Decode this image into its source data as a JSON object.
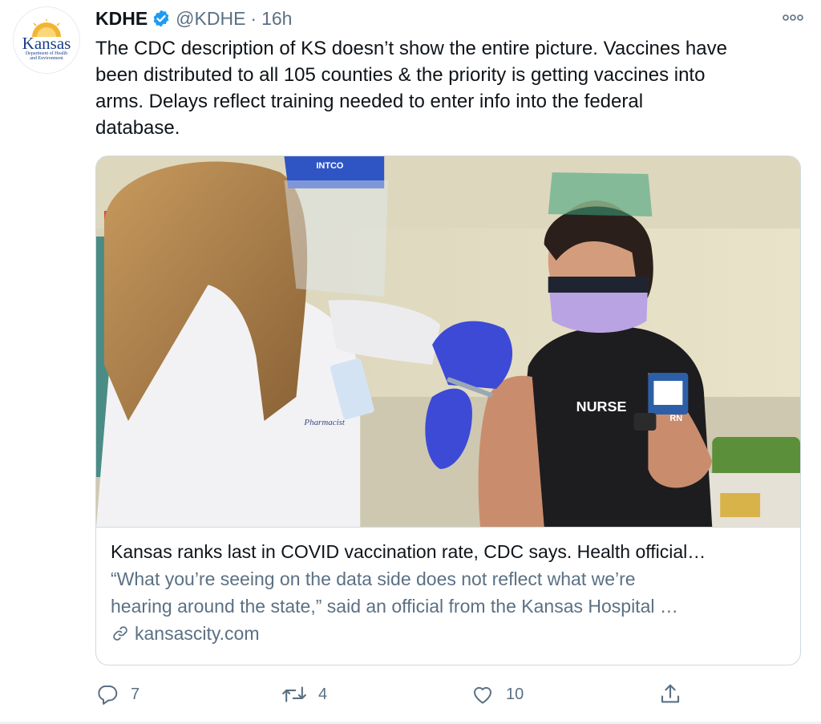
{
  "tweet": {
    "author_name": "KDHE",
    "handle": "@KDHE",
    "separator": "·",
    "time": "16h",
    "text": "The CDC description of KS doesn’t show the entire picture. Vaccines have\nbeen distributed to all 105 counties & the priority is getting vaccines into\narms. Delays reflect training needed to enter info into the federal\ndatabase."
  },
  "avatar": {
    "logo_word": "Kansas",
    "logo_sub": "Department of Health and Environment"
  },
  "card": {
    "image_overlay": {
      "cap_text": "INTCO",
      "shirt_text": "NURSE",
      "badge_text": "RN",
      "coat_name": "Pharmacist"
    },
    "title": "Kansas ranks last in COVID vaccination rate, CDC says. Health official…",
    "description": "“What you’re seeing on the data side does not reflect what we’re\nhearing around the state,” said an official from the Kansas Hospital …",
    "domain": "kansascity.com"
  },
  "actions": {
    "reply_count": "7",
    "retweet_count": "4",
    "like_count": "10"
  },
  "icons": {
    "verified": "verified-badge-icon",
    "more": "more-icon",
    "reply": "reply-icon",
    "retweet": "retweet-icon",
    "like": "like-icon",
    "share": "share-icon",
    "link": "link-icon"
  },
  "colors": {
    "verified_blue": "#1d9bf0",
    "secondary_text": "#5b7083",
    "border": "#cfd9de",
    "kansas_blue": "#1d3f8a",
    "kansas_gold": "#f2b531"
  }
}
